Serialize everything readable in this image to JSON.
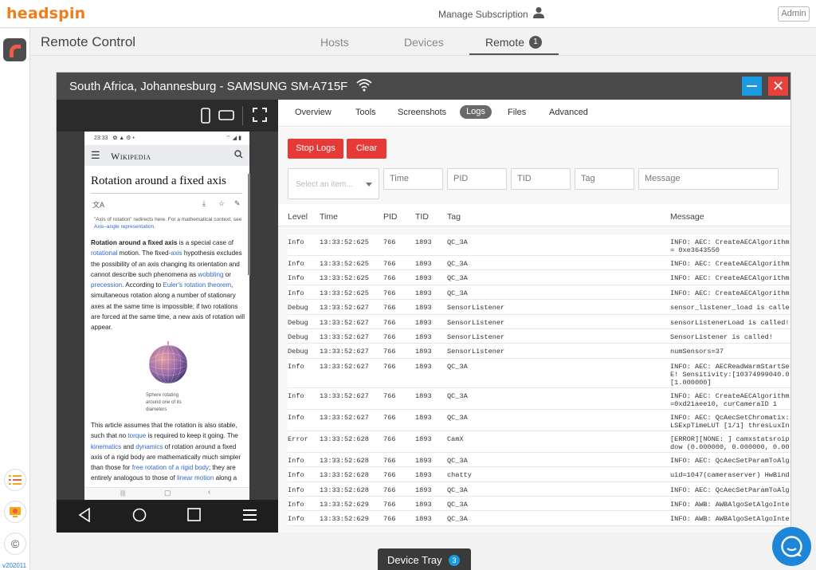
{
  "brand": {
    "name": "headspin",
    "version": "v202011"
  },
  "topbar": {
    "manage_subscription": "Manage Subscription",
    "admin_label": "Admin"
  },
  "header": {
    "title": "Remote Control",
    "tabs": [
      {
        "label": "Hosts"
      },
      {
        "label": "Devices"
      },
      {
        "label": "Remote",
        "badge": "1",
        "active": true
      }
    ]
  },
  "device_window": {
    "title": "South Africa, Johannesburg - SAMSUNG SM-A715F",
    "phone": {
      "status_time": "23:33",
      "wiki_logo": "Wikipedia",
      "article_title": "Rotation around a fixed axis",
      "redirect_note": "\"Axis of rotation\" redirects here. For a mathematical context, see",
      "redirect_link": "Axis–angle representation",
      "sphere_caption": "Sphere rotating around one of its diameters"
    },
    "subtabs": [
      {
        "label": "Overview"
      },
      {
        "label": "Tools"
      },
      {
        "label": "Screenshots"
      },
      {
        "label": "Logs",
        "active": true
      },
      {
        "label": "Files"
      },
      {
        "label": "Advanced"
      }
    ],
    "buttons": {
      "stop_logs": "Stop Logs",
      "clear": "Clear"
    },
    "filters": {
      "select_placeholder": "Select an item...",
      "time": "Time",
      "pid": "PID",
      "tid": "TID",
      "tag": "Tag",
      "message": "Message"
    },
    "log_columns": [
      "Level",
      "Time",
      "PID",
      "TID",
      "Tag",
      "Message"
    ],
    "log_rows": [
      [
        "Info",
        "13:33:52:625",
        "766",
        "1893",
        "QC_3A",
        "INFO: AEC: CreateAECAlgorithm\n= 0xe3643550"
      ],
      [
        "Info",
        "13:33:52:625",
        "766",
        "1893",
        "QC_3A",
        "INFO: AEC: CreateAECAlgorithm"
      ],
      [
        "Info",
        "13:33:52:625",
        "766",
        "1893",
        "QC_3A",
        "INFO: AEC: CreateAECAlgorithm"
      ],
      [
        "Info",
        "13:33:52:625",
        "766",
        "1893",
        "QC_3A",
        "INFO: AEC: CreateAECAlgorithm"
      ],
      [
        "Debug",
        "13:33:52:627",
        "766",
        "1893",
        "SensorListener",
        "sensor_listener_load is calle"
      ],
      [
        "Debug",
        "13:33:52:627",
        "766",
        "1893",
        "SensorListener",
        "sensorListenerLoad is called!"
      ],
      [
        "Debug",
        "13:33:52:627",
        "766",
        "1893",
        "SensorListener",
        "SensorListener is called!"
      ],
      [
        "Debug",
        "13:33:52:627",
        "766",
        "1893",
        "SensorListener",
        "numSensors=37"
      ],
      [
        "Info",
        "13:33:52:627",
        "766",
        "1893",
        "QC_3A",
        "INFO: AEC: AECReadWarmStartSe\nE! Sensitivity:[10374999040.0\n[1.000000]"
      ],
      [
        "Info",
        "13:33:52:627",
        "766",
        "1893",
        "QC_3A",
        "INFO: AEC: CreateAECAlgorithm\n=0xd21aee10, curCameraID 1"
      ],
      [
        "Info",
        "13:33:52:627",
        "766",
        "1893",
        "QC_3A",
        "INFO: AEC: QcAecSetChromatix:\nLSExpTimeLUT [1/1] thresLuxIn"
      ],
      [
        "Error",
        "13:33:52:628",
        "766",
        "1893",
        "CamX",
        "[ERROR][NONE: ] camxstatsroip\ndow (0.000000, 0.000000, 0.00"
      ],
      [
        "Info",
        "13:33:52:628",
        "766",
        "1893",
        "QC_3A",
        "INFO: AEC: QcAecSetParamToAlg"
      ],
      [
        "Info",
        "13:33:52:628",
        "766",
        "1893",
        "chatty",
        "uid=1047(cameraserver) HwBind"
      ],
      [
        "Info",
        "13:33:52:628",
        "766",
        "1893",
        "QC_3A",
        "INFO: AEC: QcAecSetParamToAlg"
      ],
      [
        "Info",
        "13:33:52:629",
        "766",
        "1893",
        "QC_3A",
        "INFO: AWB: AWBAlgoSetAlgoInte"
      ],
      [
        "Info",
        "13:33:52:629",
        "766",
        "1893",
        "QC_3A",
        "INFO: AWB: AWBAlgoSetAlgoInte"
      ]
    ]
  },
  "device_tray": {
    "label": "Device Tray",
    "count": "3"
  }
}
